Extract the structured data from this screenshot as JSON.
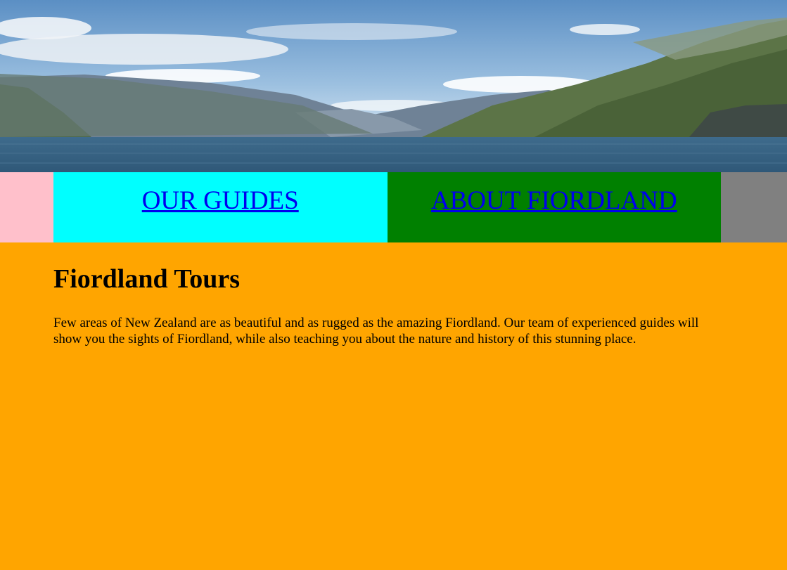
{
  "colors": {
    "page_background": "#FFA500",
    "nav_left_side": "#FFC0CB",
    "nav_right_side": "#808080",
    "link": "#0000EE"
  },
  "hero": {
    "image": "fjord-landscape-photo"
  },
  "nav": {
    "items": [
      {
        "label": "OUR GUIDES",
        "background": "#00FFFF"
      },
      {
        "label": "ABOUT FIORDLAND",
        "background": "#008000"
      }
    ]
  },
  "main": {
    "title": "Fiordland Tours",
    "intro": "Few areas of New Zealand are as beautiful and as rugged as the amazing Fiordland. Our team of experienced guides will show you the sights of Fiordland, while also teaching you about the nature and history of this stunning place."
  }
}
